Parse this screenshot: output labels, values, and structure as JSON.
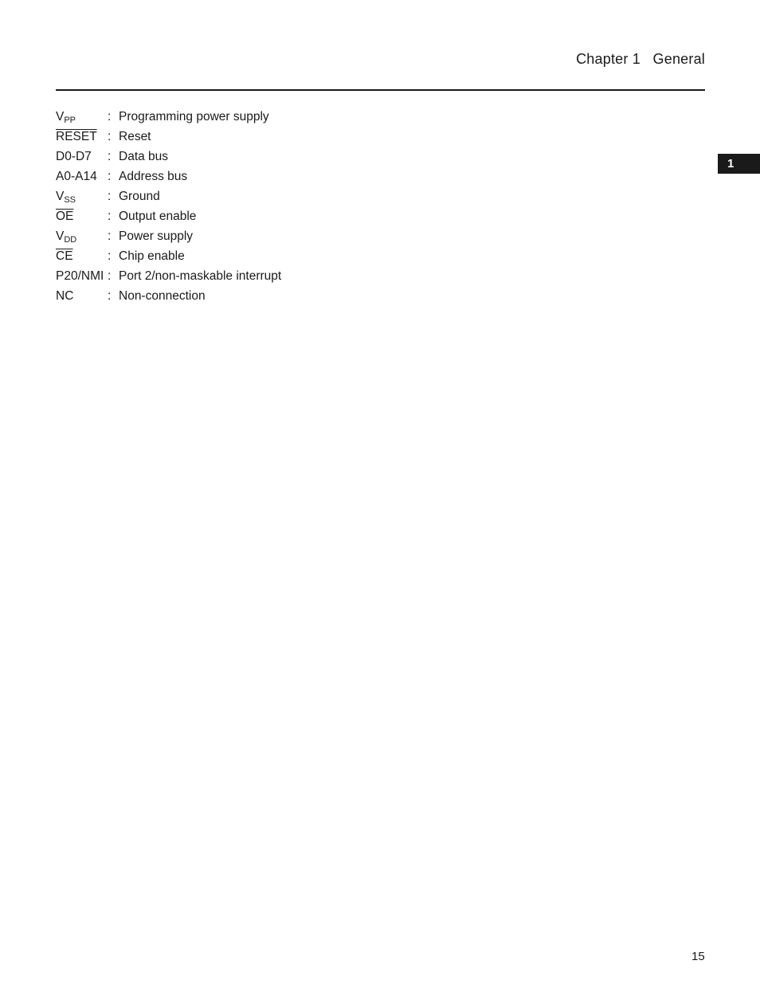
{
  "header": {
    "title": "Chapter 1   General"
  },
  "chapter_tab": {
    "label": "1"
  },
  "pins": [
    {
      "base": "V",
      "sub": "PP",
      "overline": false,
      "desc": "Programming power supply"
    },
    {
      "base": "RESET",
      "sub": "",
      "overline": true,
      "desc": "Reset"
    },
    {
      "base": "D0-D7",
      "sub": "",
      "overline": false,
      "desc": "Data bus"
    },
    {
      "base": "A0-A14",
      "sub": "",
      "overline": false,
      "desc": "Address bus"
    },
    {
      "base": "V",
      "sub": "SS",
      "overline": false,
      "desc": "Ground"
    },
    {
      "base": "OE",
      "sub": "",
      "overline": true,
      "desc": "Output enable"
    },
    {
      "base": "V",
      "sub": "DD",
      "overline": false,
      "desc": "Power supply"
    },
    {
      "base": "CE",
      "sub": "",
      "overline": true,
      "desc": "Chip enable"
    },
    {
      "base": "P20/NMI",
      "sub": "",
      "overline": false,
      "desc": "Port 2/non-maskable interrupt"
    },
    {
      "base": "NC",
      "sub": "",
      "overline": false,
      "desc": "Non-connection"
    }
  ],
  "separator": ":",
  "footer": {
    "page_number": "15"
  }
}
